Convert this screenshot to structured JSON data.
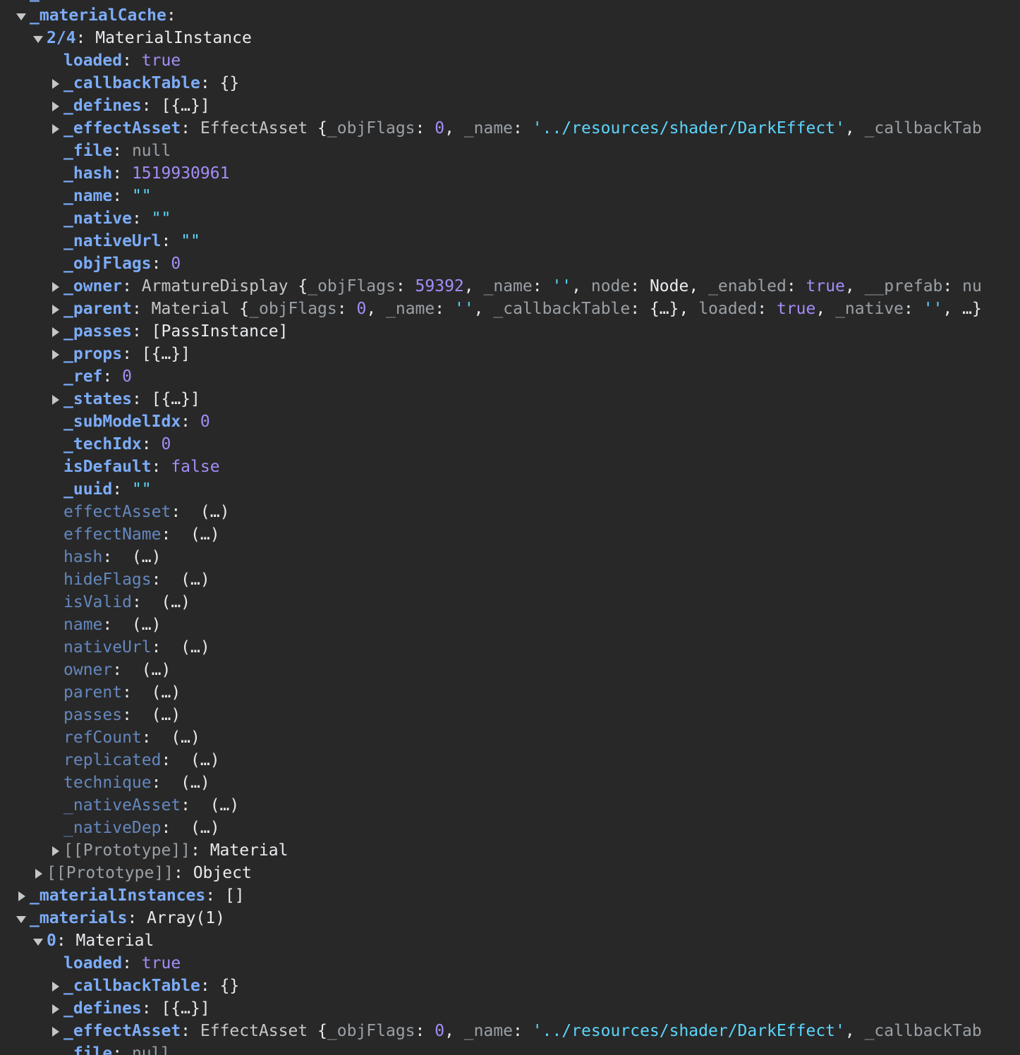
{
  "colors": {
    "background": "#282828",
    "key": "#7cacf8",
    "number_bool": "#a58cf7",
    "string": "#5cd5fb",
    "null": "#9aa0a6",
    "text": "#e8eaed"
  },
  "rows": [
    {
      "indent": 0,
      "toggle": "none",
      "parts": [
        {
          "t": "_",
          "c": "k"
        }
      ]
    },
    {
      "indent": 0,
      "toggle": "open",
      "parts": [
        {
          "t": "_materialCache",
          "c": "k"
        },
        {
          "t": ":",
          "c": "p"
        }
      ]
    },
    {
      "indent": 1,
      "toggle": "open",
      "parts": [
        {
          "t": "2/4",
          "c": "k"
        },
        {
          "t": ": MaterialInstance",
          "c": "p"
        }
      ]
    },
    {
      "indent": 2,
      "toggle": "none",
      "parts": [
        {
          "t": "loaded",
          "c": "k"
        },
        {
          "t": ": ",
          "c": "p"
        },
        {
          "t": "true",
          "c": "b"
        }
      ]
    },
    {
      "indent": 2,
      "toggle": "closed",
      "parts": [
        {
          "t": "_callbackTable",
          "c": "k"
        },
        {
          "t": ": {}",
          "c": "p"
        }
      ]
    },
    {
      "indent": 2,
      "toggle": "closed",
      "parts": [
        {
          "t": "_defines",
          "c": "k"
        },
        {
          "t": ": [{…}]",
          "c": "p"
        }
      ]
    },
    {
      "indent": 2,
      "toggle": "closed",
      "parts": [
        {
          "t": "_effectAsset",
          "c": "k"
        },
        {
          "t": ": ",
          "c": "p"
        },
        {
          "t": "EffectAsset",
          "c": "gry"
        },
        {
          "t": " {",
          "c": "p"
        },
        {
          "t": "_objFlags",
          "c": "key2"
        },
        {
          "t": ": ",
          "c": "p"
        },
        {
          "t": "0",
          "c": "n"
        },
        {
          "t": ", ",
          "c": "p"
        },
        {
          "t": "_name",
          "c": "key2"
        },
        {
          "t": ": ",
          "c": "p"
        },
        {
          "t": "'../resources/shader/DarkEffect'",
          "c": "sq"
        },
        {
          "t": ", ",
          "c": "p"
        },
        {
          "t": "_callbackTab",
          "c": "key2"
        }
      ]
    },
    {
      "indent": 2,
      "toggle": "none",
      "parts": [
        {
          "t": "_file",
          "c": "k"
        },
        {
          "t": ": ",
          "c": "p"
        },
        {
          "t": "null",
          "c": "nl"
        }
      ]
    },
    {
      "indent": 2,
      "toggle": "none",
      "parts": [
        {
          "t": "_hash",
          "c": "k"
        },
        {
          "t": ": ",
          "c": "p"
        },
        {
          "t": "1519930961",
          "c": "n"
        }
      ]
    },
    {
      "indent": 2,
      "toggle": "none",
      "parts": [
        {
          "t": "_name",
          "c": "k"
        },
        {
          "t": ": ",
          "c": "p"
        },
        {
          "t": "\"\"",
          "c": "s"
        }
      ]
    },
    {
      "indent": 2,
      "toggle": "none",
      "parts": [
        {
          "t": "_native",
          "c": "k"
        },
        {
          "t": ": ",
          "c": "p"
        },
        {
          "t": "\"\"",
          "c": "s"
        }
      ]
    },
    {
      "indent": 2,
      "toggle": "none",
      "parts": [
        {
          "t": "_nativeUrl",
          "c": "k"
        },
        {
          "t": ": ",
          "c": "p"
        },
        {
          "t": "\"\"",
          "c": "s"
        }
      ]
    },
    {
      "indent": 2,
      "toggle": "none",
      "parts": [
        {
          "t": "_objFlags",
          "c": "k"
        },
        {
          "t": ": ",
          "c": "p"
        },
        {
          "t": "0",
          "c": "n"
        }
      ]
    },
    {
      "indent": 2,
      "toggle": "closed",
      "parts": [
        {
          "t": "_owner",
          "c": "k"
        },
        {
          "t": ": ",
          "c": "p"
        },
        {
          "t": "ArmatureDisplay",
          "c": "gry"
        },
        {
          "t": " {",
          "c": "p"
        },
        {
          "t": "_objFlags",
          "c": "key2"
        },
        {
          "t": ": ",
          "c": "p"
        },
        {
          "t": "59392",
          "c": "n"
        },
        {
          "t": ", ",
          "c": "p"
        },
        {
          "t": "_name",
          "c": "key2"
        },
        {
          "t": ": ",
          "c": "p"
        },
        {
          "t": "''",
          "c": "sq"
        },
        {
          "t": ", ",
          "c": "p"
        },
        {
          "t": "node",
          "c": "key2"
        },
        {
          "t": ": Node, ",
          "c": "p"
        },
        {
          "t": "_enabled",
          "c": "key2"
        },
        {
          "t": ": ",
          "c": "p"
        },
        {
          "t": "true",
          "c": "b"
        },
        {
          "t": ", ",
          "c": "p"
        },
        {
          "t": "__prefab",
          "c": "key2"
        },
        {
          "t": ": ",
          "c": "p"
        },
        {
          "t": "nu",
          "c": "nl"
        }
      ]
    },
    {
      "indent": 2,
      "toggle": "closed",
      "parts": [
        {
          "t": "_parent",
          "c": "k"
        },
        {
          "t": ": ",
          "c": "p"
        },
        {
          "t": "Material",
          "c": "gry"
        },
        {
          "t": " {",
          "c": "p"
        },
        {
          "t": "_objFlags",
          "c": "key2"
        },
        {
          "t": ": ",
          "c": "p"
        },
        {
          "t": "0",
          "c": "n"
        },
        {
          "t": ", ",
          "c": "p"
        },
        {
          "t": "_name",
          "c": "key2"
        },
        {
          "t": ": ",
          "c": "p"
        },
        {
          "t": "''",
          "c": "sq"
        },
        {
          "t": ", ",
          "c": "p"
        },
        {
          "t": "_callbackTable",
          "c": "key2"
        },
        {
          "t": ": {…}, ",
          "c": "p"
        },
        {
          "t": "loaded",
          "c": "key2"
        },
        {
          "t": ": ",
          "c": "p"
        },
        {
          "t": "true",
          "c": "b"
        },
        {
          "t": ", ",
          "c": "p"
        },
        {
          "t": "_native",
          "c": "key2"
        },
        {
          "t": ": ",
          "c": "p"
        },
        {
          "t": "''",
          "c": "sq"
        },
        {
          "t": ", …}",
          "c": "p"
        }
      ]
    },
    {
      "indent": 2,
      "toggle": "closed",
      "parts": [
        {
          "t": "_passes",
          "c": "k"
        },
        {
          "t": ": [PassInstance]",
          "c": "p"
        }
      ]
    },
    {
      "indent": 2,
      "toggle": "closed",
      "parts": [
        {
          "t": "_props",
          "c": "k"
        },
        {
          "t": ": [{…}]",
          "c": "p"
        }
      ]
    },
    {
      "indent": 2,
      "toggle": "none",
      "parts": [
        {
          "t": "_ref",
          "c": "k"
        },
        {
          "t": ": ",
          "c": "p"
        },
        {
          "t": "0",
          "c": "n"
        }
      ]
    },
    {
      "indent": 2,
      "toggle": "closed",
      "parts": [
        {
          "t": "_states",
          "c": "k"
        },
        {
          "t": ": [{…}]",
          "c": "p"
        }
      ]
    },
    {
      "indent": 2,
      "toggle": "none",
      "parts": [
        {
          "t": "_subModelIdx",
          "c": "k"
        },
        {
          "t": ": ",
          "c": "p"
        },
        {
          "t": "0",
          "c": "n"
        }
      ]
    },
    {
      "indent": 2,
      "toggle": "none",
      "parts": [
        {
          "t": "_techIdx",
          "c": "k"
        },
        {
          "t": ": ",
          "c": "p"
        },
        {
          "t": "0",
          "c": "n"
        }
      ]
    },
    {
      "indent": 2,
      "toggle": "none",
      "parts": [
        {
          "t": "isDefault",
          "c": "k"
        },
        {
          "t": ": ",
          "c": "p"
        },
        {
          "t": "false",
          "c": "b"
        }
      ]
    },
    {
      "indent": 2,
      "toggle": "none",
      "parts": [
        {
          "t": "_uuid",
          "c": "k"
        },
        {
          "t": ": ",
          "c": "p"
        },
        {
          "t": "\"\"",
          "c": "s"
        }
      ]
    },
    {
      "indent": 2,
      "toggle": "none",
      "parts": [
        {
          "t": "effectAsset",
          "c": "kp"
        },
        {
          "t": ":  (…)",
          "c": "p"
        }
      ]
    },
    {
      "indent": 2,
      "toggle": "none",
      "parts": [
        {
          "t": "effectName",
          "c": "kp"
        },
        {
          "t": ":  (…)",
          "c": "p"
        }
      ]
    },
    {
      "indent": 2,
      "toggle": "none",
      "parts": [
        {
          "t": "hash",
          "c": "kp"
        },
        {
          "t": ":  (…)",
          "c": "p"
        }
      ]
    },
    {
      "indent": 2,
      "toggle": "none",
      "parts": [
        {
          "t": "hideFlags",
          "c": "kp"
        },
        {
          "t": ":  (…)",
          "c": "p"
        }
      ]
    },
    {
      "indent": 2,
      "toggle": "none",
      "parts": [
        {
          "t": "isValid",
          "c": "kp"
        },
        {
          "t": ":  (…)",
          "c": "p"
        }
      ]
    },
    {
      "indent": 2,
      "toggle": "none",
      "parts": [
        {
          "t": "name",
          "c": "kp"
        },
        {
          "t": ":  (…)",
          "c": "p"
        }
      ]
    },
    {
      "indent": 2,
      "toggle": "none",
      "parts": [
        {
          "t": "nativeUrl",
          "c": "kp"
        },
        {
          "t": ":  (…)",
          "c": "p"
        }
      ]
    },
    {
      "indent": 2,
      "toggle": "none",
      "parts": [
        {
          "t": "owner",
          "c": "kp"
        },
        {
          "t": ":  (…)",
          "c": "p"
        }
      ]
    },
    {
      "indent": 2,
      "toggle": "none",
      "parts": [
        {
          "t": "parent",
          "c": "kp"
        },
        {
          "t": ":  (…)",
          "c": "p"
        }
      ]
    },
    {
      "indent": 2,
      "toggle": "none",
      "parts": [
        {
          "t": "passes",
          "c": "kp"
        },
        {
          "t": ":  (…)",
          "c": "p"
        }
      ]
    },
    {
      "indent": 2,
      "toggle": "none",
      "parts": [
        {
          "t": "refCount",
          "c": "kp"
        },
        {
          "t": ":  (…)",
          "c": "p"
        }
      ]
    },
    {
      "indent": 2,
      "toggle": "none",
      "parts": [
        {
          "t": "replicated",
          "c": "kp"
        },
        {
          "t": ":  (…)",
          "c": "p"
        }
      ]
    },
    {
      "indent": 2,
      "toggle": "none",
      "parts": [
        {
          "t": "technique",
          "c": "kp"
        },
        {
          "t": ":  (…)",
          "c": "p"
        }
      ]
    },
    {
      "indent": 2,
      "toggle": "none",
      "parts": [
        {
          "t": "_nativeAsset",
          "c": "kp"
        },
        {
          "t": ":  (…)",
          "c": "p"
        }
      ]
    },
    {
      "indent": 2,
      "toggle": "none",
      "parts": [
        {
          "t": "_nativeDep",
          "c": "kp"
        },
        {
          "t": ":  (…)",
          "c": "p"
        }
      ]
    },
    {
      "indent": 2,
      "toggle": "closed",
      "parts": [
        {
          "t": "[[Prototype]]",
          "c": "kd"
        },
        {
          "t": ": Material",
          "c": "p"
        }
      ]
    },
    {
      "indent": 1,
      "toggle": "closed",
      "parts": [
        {
          "t": "[[Prototype]]",
          "c": "kd"
        },
        {
          "t": ": Object",
          "c": "p"
        }
      ]
    },
    {
      "indent": 0,
      "toggle": "closed",
      "parts": [
        {
          "t": "_materialInstances",
          "c": "k"
        },
        {
          "t": ": []",
          "c": "p"
        }
      ]
    },
    {
      "indent": 0,
      "toggle": "open",
      "parts": [
        {
          "t": "_materials",
          "c": "k"
        },
        {
          "t": ": Array(1)",
          "c": "p"
        }
      ]
    },
    {
      "indent": 1,
      "toggle": "open",
      "parts": [
        {
          "t": "0",
          "c": "k"
        },
        {
          "t": ": Material",
          "c": "p"
        }
      ]
    },
    {
      "indent": 2,
      "toggle": "none",
      "parts": [
        {
          "t": "loaded",
          "c": "k"
        },
        {
          "t": ": ",
          "c": "p"
        },
        {
          "t": "true",
          "c": "b"
        }
      ]
    },
    {
      "indent": 2,
      "toggle": "closed",
      "parts": [
        {
          "t": "_callbackTable",
          "c": "k"
        },
        {
          "t": ": {}",
          "c": "p"
        }
      ]
    },
    {
      "indent": 2,
      "toggle": "closed",
      "parts": [
        {
          "t": "_defines",
          "c": "k"
        },
        {
          "t": ": [{…}]",
          "c": "p"
        }
      ]
    },
    {
      "indent": 2,
      "toggle": "closed",
      "parts": [
        {
          "t": "_effectAsset",
          "c": "k"
        },
        {
          "t": ": ",
          "c": "p"
        },
        {
          "t": "EffectAsset",
          "c": "gry"
        },
        {
          "t": " {",
          "c": "p"
        },
        {
          "t": "_objFlags",
          "c": "key2"
        },
        {
          "t": ": ",
          "c": "p"
        },
        {
          "t": "0",
          "c": "n"
        },
        {
          "t": ", ",
          "c": "p"
        },
        {
          "t": "_name",
          "c": "key2"
        },
        {
          "t": ": ",
          "c": "p"
        },
        {
          "t": "'../resources/shader/DarkEffect'",
          "c": "sq"
        },
        {
          "t": ", ",
          "c": "p"
        },
        {
          "t": "_callbackTab",
          "c": "key2"
        }
      ]
    },
    {
      "indent": 2,
      "toggle": "none",
      "parts": [
        {
          "t": "_file",
          "c": "k"
        },
        {
          "t": ": ",
          "c": "p"
        },
        {
          "t": "null",
          "c": "nl"
        }
      ]
    }
  ]
}
